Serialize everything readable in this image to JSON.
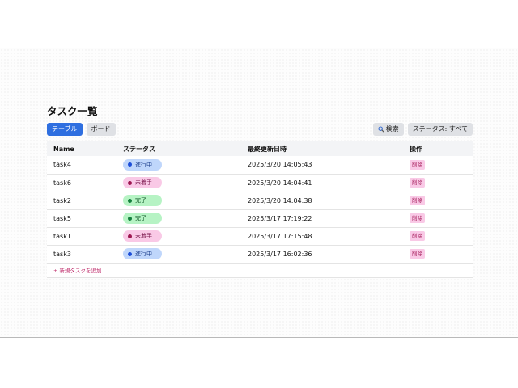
{
  "page": {
    "title": "タスク一覧"
  },
  "view_tabs": [
    {
      "label": "テーブル",
      "active": true
    },
    {
      "label": "ボード",
      "active": false
    }
  ],
  "toolbar": {
    "search_label": "検索",
    "status_filter_label": "ステータス: すべて"
  },
  "table": {
    "headers": {
      "name": "Name",
      "status": "ステータス",
      "updated": "最終更新日時",
      "actions": "操作"
    },
    "rows": [
      {
        "name": "task4",
        "status": "進行中",
        "status_kind": "progress",
        "updated": "2025/3/20 14:05:43",
        "action": "削除"
      },
      {
        "name": "task6",
        "status": "未着手",
        "status_kind": "todo",
        "updated": "2025/3/20 14:04:41",
        "action": "削除"
      },
      {
        "name": "task2",
        "status": "完了",
        "status_kind": "done",
        "updated": "2025/3/20 14:04:38",
        "action": "削除"
      },
      {
        "name": "task5",
        "status": "完了",
        "status_kind": "done",
        "updated": "2025/3/17 17:19:22",
        "action": "削除"
      },
      {
        "name": "task1",
        "status": "未着手",
        "status_kind": "todo",
        "updated": "2025/3/17 17:15:48",
        "action": "削除"
      },
      {
        "name": "task3",
        "status": "進行中",
        "status_kind": "progress",
        "updated": "2025/3/17 16:02:36",
        "action": "削除"
      }
    ],
    "add_label": "+ 新規タスクを追加"
  },
  "colors": {
    "accent": "#2f6fe0",
    "progress": "#bfd6fb",
    "todo": "#f9c9e6",
    "done": "#b6f3c4"
  }
}
